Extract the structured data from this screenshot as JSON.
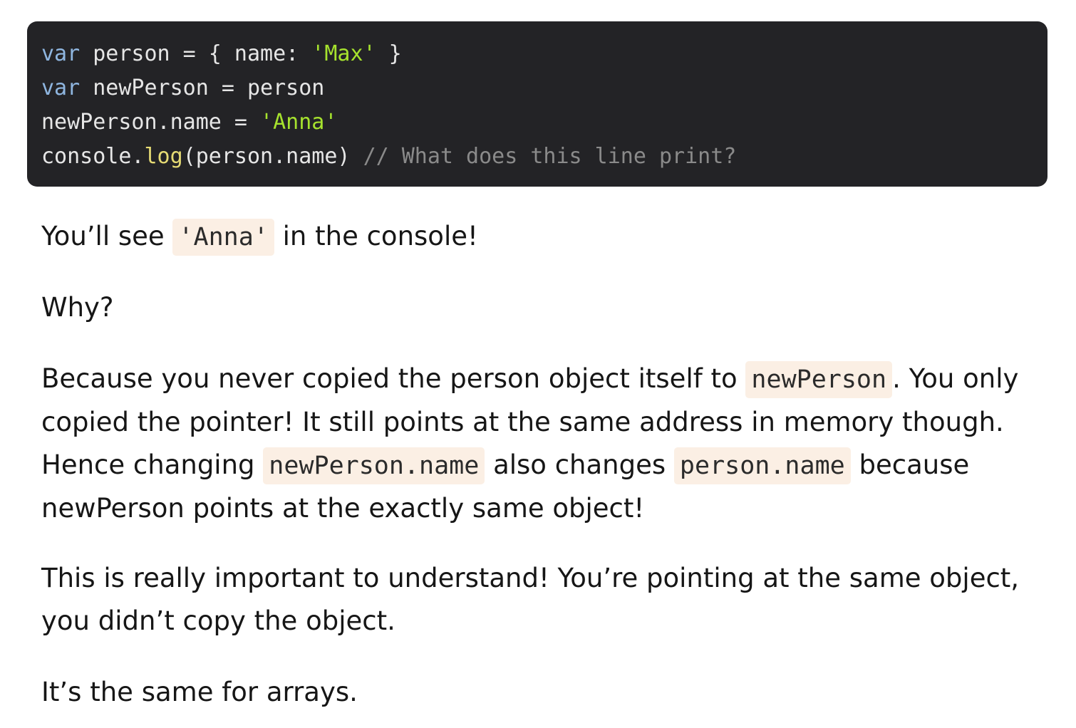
{
  "code": {
    "line1": {
      "kw": "var",
      "ident": " person = { name: ",
      "str": "'Max'",
      "tail": " }"
    },
    "line2": {
      "kw": "var",
      "rest": " newPerson = person"
    },
    "line3": {
      "ident": "newPerson.name = ",
      "str": "'Anna'"
    },
    "line4": {
      "obj": "console.",
      "fn": "log",
      "args": "(person.name) ",
      "comment": "// What does this line print?"
    }
  },
  "paragraph1": {
    "before": "You’ll see ",
    "code": "'Anna'",
    "after": " in the console!"
  },
  "paragraph2": {
    "text": "Why?"
  },
  "paragraph3": {
    "part1": "Because you never copied the person object itself to ",
    "code1": "newPerson",
    "part2": ". You only copied the pointer! It still points at the same address in memory though. Hence changing ",
    "code2": "newPerson.name",
    "part3": " also changes ",
    "code3": "person.name",
    "part4": " because newPerson points at the exactly same object!"
  },
  "paragraph4": {
    "text": "This is really important to understand! You’re pointing at the same object, you didn’t copy the object."
  },
  "paragraph5": {
    "text": "It’s the same for arrays."
  }
}
